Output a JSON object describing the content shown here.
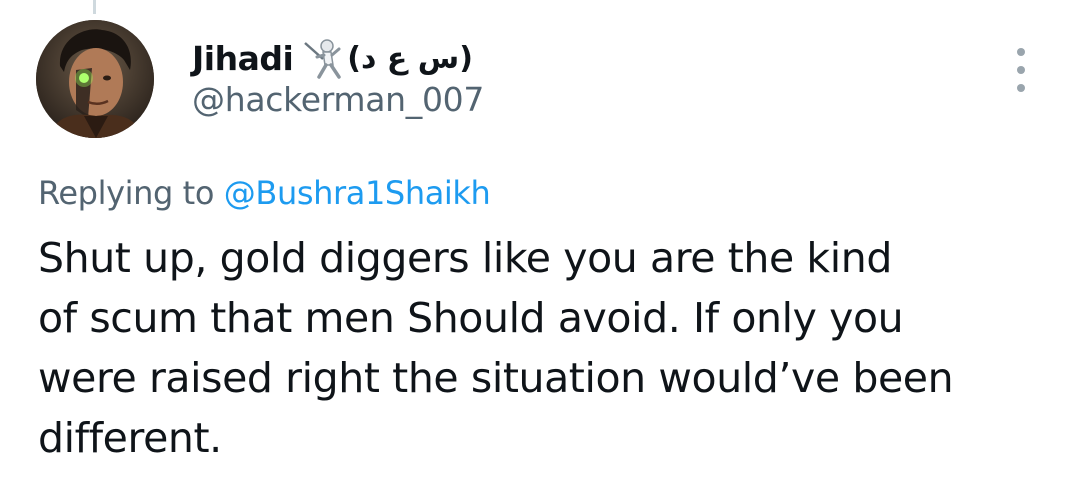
{
  "tweet": {
    "author": {
      "display_name": "Jihadi",
      "name_emoji_icon": "person-fencing-icon",
      "name_suffix": "(س ع د)",
      "handle": "@hackerman_007",
      "avatar_icon": "user-avatar"
    },
    "more_options_icon": "vertical-ellipsis-icon",
    "replying_to_label": "Replying to",
    "replying_to_handle": "@Bushra1Shaikh",
    "text_lines": [
      "Shut up, gold diggers like you are the kind",
      "of scum that men Should avoid. If only you",
      "were raised right the situation would’ve been",
      "different."
    ]
  },
  "colors": {
    "text_primary": "#0f1419",
    "text_secondary": "#536471",
    "link": "#1d9bf0",
    "thread_line": "#cfd9de"
  }
}
